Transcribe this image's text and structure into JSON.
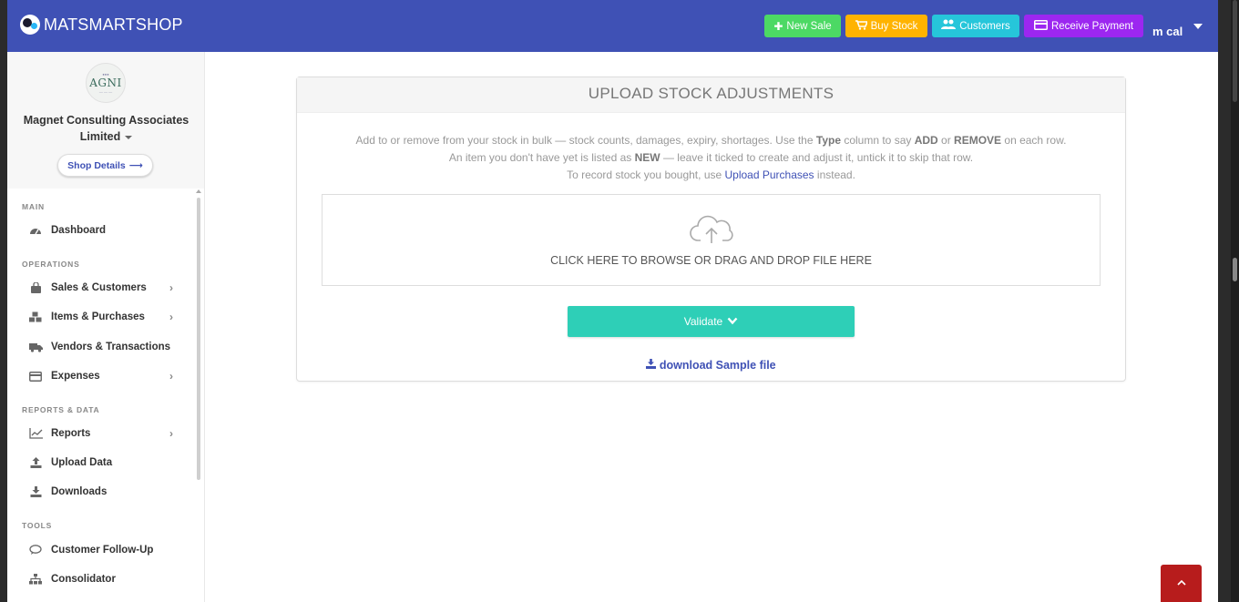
{
  "app": {
    "brand": "MATSMARTSHOP"
  },
  "topbar": {
    "buttons": [
      {
        "label": "New Sale",
        "icon": "plus-icon",
        "color": "#4cd964"
      },
      {
        "label": "Buy Stock",
        "icon": "cart-icon",
        "color": "#ffb300"
      },
      {
        "label": "Customers",
        "icon": "users-icon",
        "color": "#26c6da"
      },
      {
        "label": "Receive Payment",
        "icon": "credit-card-icon",
        "color": "#9c27f0"
      }
    ],
    "user": "m cal"
  },
  "sidebar": {
    "org_logo_text": "AGNI",
    "org_name_line1": "Magnet Consulting Associates",
    "org_name_line2": "Limited",
    "shop_details": "Shop Details",
    "sections": {
      "main": "MAIN",
      "operations": "OPERATIONS",
      "reports": "REPORTS & DATA",
      "tools": "TOOLS"
    },
    "items": [
      {
        "label": "Dashboard",
        "icon": "dashboard-icon"
      },
      {
        "label": "Sales & Customers",
        "icon": "shopping-bag-icon"
      },
      {
        "label": "Items & Purchases",
        "icon": "cubes-icon"
      },
      {
        "label": "Vendors & Transactions",
        "icon": "truck-icon"
      },
      {
        "label": "Expenses",
        "icon": "credit-card-icon"
      },
      {
        "label": "Reports",
        "icon": "line-chart-icon"
      },
      {
        "label": "Upload Data",
        "icon": "upload-icon"
      },
      {
        "label": "Downloads",
        "icon": "download-icon"
      },
      {
        "label": "Customer Follow-Up",
        "icon": "chat-icon"
      },
      {
        "label": "Consolidator",
        "icon": "sitemap-icon"
      }
    ]
  },
  "card": {
    "title": "UPLOAD STOCK ADJUSTMENTS",
    "instr1_a": "Add to or remove from your stock in bulk — stock counts, damages, expiry, shortages. Use the ",
    "instr1_type": "Type",
    "instr1_b": " column to say ",
    "instr1_add": "ADD",
    "instr1_c": " or ",
    "instr1_remove": "REMOVE",
    "instr1_d": " on each row.",
    "instr2_a": "An item you don't have yet is listed as ",
    "instr2_new": "NEW",
    "instr2_b": " — leave it ticked to create and adjust it, untick it to skip that row.",
    "instr3_a": "To record stock you bought, use ",
    "instr3_link": "Upload Purchases",
    "instr3_b": " instead.",
    "dropzone": "CLICK HERE TO BROWSE OR DRAG AND DROP FILE HERE",
    "validate": "Validate",
    "download": "download Sample file"
  }
}
